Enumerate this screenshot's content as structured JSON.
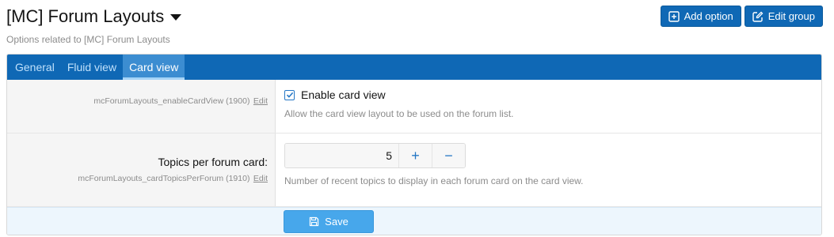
{
  "header": {
    "title": "[MC] Forum Layouts",
    "description": "Options related to [MC] Forum Layouts",
    "add_option_label": "Add option",
    "edit_group_label": "Edit group"
  },
  "tabs": [
    {
      "label": "General"
    },
    {
      "label": "Fluid view"
    },
    {
      "label": "Card view"
    }
  ],
  "active_tab": "Card view",
  "options": {
    "enable_card_view": {
      "id_hint": "mcForumLayouts_enableCardView (1900)",
      "edit_label": "Edit",
      "checkbox_label": "Enable card view",
      "checked": true,
      "explain": "Allow the card view layout to be used on the forum list."
    },
    "topics_per_card": {
      "label": "Topics per forum card:",
      "id_hint": "mcForumLayouts_cardTopicsPerForum (1910)",
      "edit_label": "Edit",
      "value": "5",
      "plus": "+",
      "minus": "−",
      "explain": "Number of recent topics to display in each forum card on the card view."
    }
  },
  "footer": {
    "save_label": "Save"
  },
  "colors": {
    "tab_bar": "#0f68b5",
    "active_tab": "#3c8dd1",
    "save_button": "#47a7eb",
    "accent": "#2577c5"
  }
}
